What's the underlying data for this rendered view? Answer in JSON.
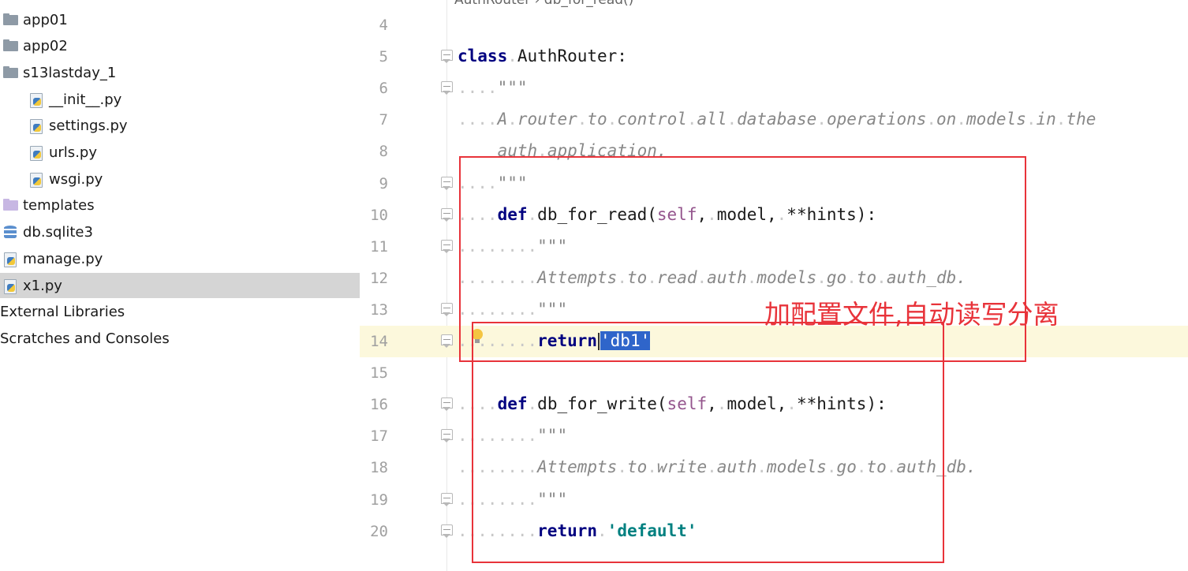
{
  "project_tree": [
    {
      "label": "app01",
      "icon": "folder-icon",
      "indent": 0
    },
    {
      "label": "app02",
      "icon": "folder-icon",
      "indent": 0
    },
    {
      "label": "s13lastday_1",
      "icon": "folder-icon",
      "indent": 0
    },
    {
      "label": "__init__.py",
      "icon": "python-file-icon",
      "indent": 1
    },
    {
      "label": "settings.py",
      "icon": "python-file-icon",
      "indent": 1
    },
    {
      "label": "urls.py",
      "icon": "python-file-icon",
      "indent": 1
    },
    {
      "label": "wsgi.py",
      "icon": "python-file-icon",
      "indent": 1
    },
    {
      "label": "templates",
      "icon": "templates-folder-icon",
      "indent": 0
    },
    {
      "label": "db.sqlite3",
      "icon": "database-icon",
      "indent": 0
    },
    {
      "label": "manage.py",
      "icon": "python-file-icon",
      "indent": 0
    },
    {
      "label": "x1.py",
      "icon": "python-file-icon",
      "indent": 0,
      "selected": true
    },
    {
      "label": "External Libraries",
      "icon": "",
      "indent": -1
    },
    {
      "label": "Scratches and Consoles",
      "icon": "",
      "indent": -1
    }
  ],
  "editor": {
    "breadcrumb": [
      "AuthRouter",
      "db_for_read()"
    ],
    "current_line": 14,
    "lines": [
      {
        "n": 4,
        "fold": false,
        "tokens": []
      },
      {
        "n": 5,
        "fold": true,
        "tokens": [
          [
            "kw",
            "class"
          ],
          [
            "ws",
            "."
          ],
          [
            "plain",
            "AuthRouter:"
          ]
        ]
      },
      {
        "n": 6,
        "fold": true,
        "tokens": [
          [
            "ws",
            "...."
          ],
          [
            "doc",
            "\"\"\""
          ]
        ]
      },
      {
        "n": 7,
        "fold": false,
        "tokens": [
          [
            "ws",
            "...."
          ],
          [
            "doc",
            "A"
          ],
          [
            "ws",
            "."
          ],
          [
            "doc",
            "router"
          ],
          [
            "ws",
            "."
          ],
          [
            "doc",
            "to"
          ],
          [
            "ws",
            "."
          ],
          [
            "doc",
            "control"
          ],
          [
            "ws",
            "."
          ],
          [
            "doc",
            "all"
          ],
          [
            "ws",
            "."
          ],
          [
            "doc",
            "database"
          ],
          [
            "ws",
            "."
          ],
          [
            "doc",
            "operations"
          ],
          [
            "ws",
            "."
          ],
          [
            "doc",
            "on"
          ],
          [
            "ws",
            "."
          ],
          [
            "doc",
            "models"
          ],
          [
            "ws",
            "."
          ],
          [
            "doc",
            "in"
          ],
          [
            "ws",
            "."
          ],
          [
            "doc",
            "the"
          ]
        ]
      },
      {
        "n": 8,
        "fold": false,
        "tokens": [
          [
            "ws",
            "    "
          ],
          [
            "doc",
            "auth"
          ],
          [
            "ws",
            "."
          ],
          [
            "doc",
            "application."
          ]
        ]
      },
      {
        "n": 9,
        "fold": true,
        "tokens": [
          [
            "ws",
            "...."
          ],
          [
            "doc",
            "\"\"\""
          ]
        ]
      },
      {
        "n": 10,
        "fold": true,
        "tokens": [
          [
            "ws",
            "...."
          ],
          [
            "kw",
            "def"
          ],
          [
            "ws",
            "."
          ],
          [
            "plain",
            "db_for_read("
          ],
          [
            "self",
            "self"
          ],
          [
            "plain",
            ","
          ],
          [
            "ws",
            "."
          ],
          [
            "plain",
            "model,"
          ],
          [
            "ws",
            "."
          ],
          [
            "plain",
            "**hints):"
          ]
        ]
      },
      {
        "n": 11,
        "fold": true,
        "tokens": [
          [
            "ws",
            "........"
          ],
          [
            "doc",
            "\"\"\""
          ]
        ]
      },
      {
        "n": 12,
        "fold": false,
        "tokens": [
          [
            "ws",
            "........"
          ],
          [
            "doc",
            "Attempts"
          ],
          [
            "ws",
            "."
          ],
          [
            "doc",
            "to"
          ],
          [
            "ws",
            "."
          ],
          [
            "doc",
            "read"
          ],
          [
            "ws",
            "."
          ],
          [
            "doc",
            "auth"
          ],
          [
            "ws",
            "."
          ],
          [
            "doc",
            "models"
          ],
          [
            "ws",
            "."
          ],
          [
            "doc",
            "go"
          ],
          [
            "ws",
            "."
          ],
          [
            "doc",
            "to"
          ],
          [
            "ws",
            "."
          ],
          [
            "doc",
            "auth_db."
          ]
        ]
      },
      {
        "n": 13,
        "fold": true,
        "tokens": [
          [
            "ws",
            "........"
          ],
          [
            "doc",
            "\"\"\""
          ]
        ]
      },
      {
        "n": 14,
        "fold": true,
        "tokens": [
          [
            "ws",
            "........"
          ],
          [
            "kw",
            "return"
          ],
          [
            "caret",
            ""
          ],
          [
            "sel",
            "'db1'"
          ]
        ]
      },
      {
        "n": 15,
        "fold": false,
        "tokens": []
      },
      {
        "n": 16,
        "fold": true,
        "tokens": [
          [
            "ws",
            "...."
          ],
          [
            "kw",
            "def"
          ],
          [
            "ws",
            "."
          ],
          [
            "plain",
            "db_for_write("
          ],
          [
            "self",
            "self"
          ],
          [
            "plain",
            ","
          ],
          [
            "ws",
            "."
          ],
          [
            "plain",
            "model,"
          ],
          [
            "ws",
            "."
          ],
          [
            "plain",
            "**hints):"
          ]
        ]
      },
      {
        "n": 17,
        "fold": true,
        "tokens": [
          [
            "ws",
            "........"
          ],
          [
            "doc",
            "\"\"\""
          ]
        ]
      },
      {
        "n": 18,
        "fold": false,
        "tokens": [
          [
            "ws",
            "........"
          ],
          [
            "doc",
            "Attempts"
          ],
          [
            "ws",
            "."
          ],
          [
            "doc",
            "to"
          ],
          [
            "ws",
            "."
          ],
          [
            "doc",
            "write"
          ],
          [
            "ws",
            "."
          ],
          [
            "doc",
            "auth"
          ],
          [
            "ws",
            "."
          ],
          [
            "doc",
            "models"
          ],
          [
            "ws",
            "."
          ],
          [
            "doc",
            "go"
          ],
          [
            "ws",
            "."
          ],
          [
            "doc",
            "to"
          ],
          [
            "ws",
            "."
          ],
          [
            "doc",
            "auth_db."
          ]
        ]
      },
      {
        "n": 19,
        "fold": true,
        "tokens": [
          [
            "ws",
            "........"
          ],
          [
            "doc",
            "\"\"\""
          ]
        ]
      },
      {
        "n": 20,
        "fold": true,
        "tokens": [
          [
            "ws",
            "........"
          ],
          [
            "kw",
            "return"
          ],
          [
            "ws",
            "."
          ],
          [
            "str",
            "'default'"
          ]
        ]
      }
    ]
  },
  "annotation": {
    "text": "加配置文件,自动读写分离",
    "color": "#e8333a"
  },
  "colors": {
    "keyword": "#000080",
    "self": "#94558d",
    "docstring": "#888888",
    "string": "#008080",
    "selection": "#2f65ca",
    "current_line": "#fcf8dc"
  }
}
